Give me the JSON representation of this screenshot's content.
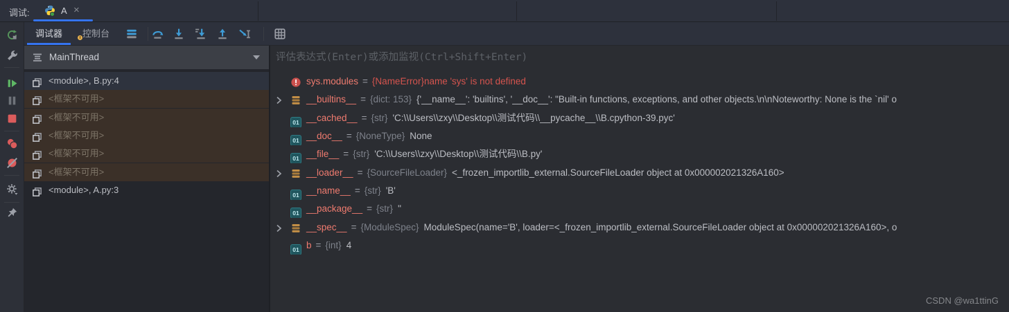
{
  "topbar": {
    "debug_label": "调试:",
    "tab_title": "A",
    "close_label": "×",
    "tab_icon": "python-logo-icon"
  },
  "left_rail": {
    "icons": [
      "rerun-icon",
      "wrench-icon",
      "resume-icon",
      "pause-icon",
      "stop-icon",
      "view-breakpoints-icon",
      "mute-breakpoints-icon",
      "settings-gear-icon",
      "pin-icon"
    ]
  },
  "toolbar": {
    "tabs": [
      {
        "label": "调试器",
        "active": true
      },
      {
        "label": "控制台",
        "active": false
      }
    ],
    "icons": [
      "show-execution-point-icon",
      "step-over-icon",
      "step-into-icon",
      "force-step-into-icon",
      "step-out-icon",
      "run-to-cursor-icon",
      "evaluate-expression-icon"
    ]
  },
  "frames": {
    "thread_name": "MainThread",
    "items": [
      {
        "label": "<module>, B.py:4",
        "state": "selected"
      },
      {
        "label": "<框架不可用>",
        "state": "unavailable"
      },
      {
        "label": "<框架不可用>",
        "state": "unavailable"
      },
      {
        "label": "<框架不可用>",
        "state": "unavailable"
      },
      {
        "label": "<框架不可用>",
        "state": "unavailable"
      },
      {
        "label": "<框架不可用>",
        "state": "unavailable"
      },
      {
        "label": "<module>, A.py:3",
        "state": "normal"
      }
    ]
  },
  "evaluate": {
    "placeholder": "评估表达式(Enter)或添加监视(Ctrl+Shift+Enter)"
  },
  "variables": {
    "eq": "=",
    "primitive_icon_label": "01",
    "rows": [
      {
        "name": "sys.modules",
        "type": "{NameError}",
        "value": "name 'sys' is not defined",
        "icon": "error",
        "expandable": false
      },
      {
        "name": "__builtins__",
        "type": "{dict: 153}",
        "value": "{'__name__': 'builtins', '__doc__': \"Built-in functions, exceptions, and other objects.\\n\\nNoteworthy: None is the `nil' o",
        "icon": "dict",
        "expandable": true
      },
      {
        "name": "__cached__",
        "type": "{str}",
        "value": "'C:\\\\Users\\\\zxy\\\\Desktop\\\\测试代码\\\\__pycache__\\\\B.cpython-39.pyc'",
        "icon": "primitive",
        "expandable": false
      },
      {
        "name": "__doc__",
        "type": "{NoneType}",
        "value": "None",
        "icon": "primitive",
        "expandable": false
      },
      {
        "name": "__file__",
        "type": "{str}",
        "value": "'C:\\\\Users\\\\zxy\\\\Desktop\\\\测试代码\\\\B.py'",
        "icon": "primitive",
        "expandable": false
      },
      {
        "name": "__loader__",
        "type": "{SourceFileLoader}",
        "value": "<_frozen_importlib_external.SourceFileLoader object at 0x000002021326A160>",
        "icon": "dict",
        "expandable": true
      },
      {
        "name": "__name__",
        "type": "{str}",
        "value": "'B'",
        "icon": "primitive",
        "expandable": false
      },
      {
        "name": "__package__",
        "type": "{str}",
        "value": "''",
        "icon": "primitive",
        "expandable": false
      },
      {
        "name": "__spec__",
        "type": "{ModuleSpec}",
        "value": "ModuleSpec(name='B', loader=<_frozen_importlib_external.SourceFileLoader object at 0x000002021326A160>, o",
        "icon": "dict",
        "expandable": true
      },
      {
        "name": "b",
        "type": "{int}",
        "value": "4",
        "icon": "primitive",
        "expandable": false
      }
    ]
  },
  "watermark": {
    "text": "CSDN @wa1ttinG"
  },
  "colors": {
    "accent_blue": "#3574f0",
    "step_icon_blue": "#3e9cd6",
    "error_red": "#d5544e",
    "variable_name": "#ef7b6f",
    "stop_red": "#db5c5c",
    "resume_green": "#5fb865",
    "unavailable_row_bg": "#3b3028",
    "selected_row_bg": "#2e333e"
  }
}
